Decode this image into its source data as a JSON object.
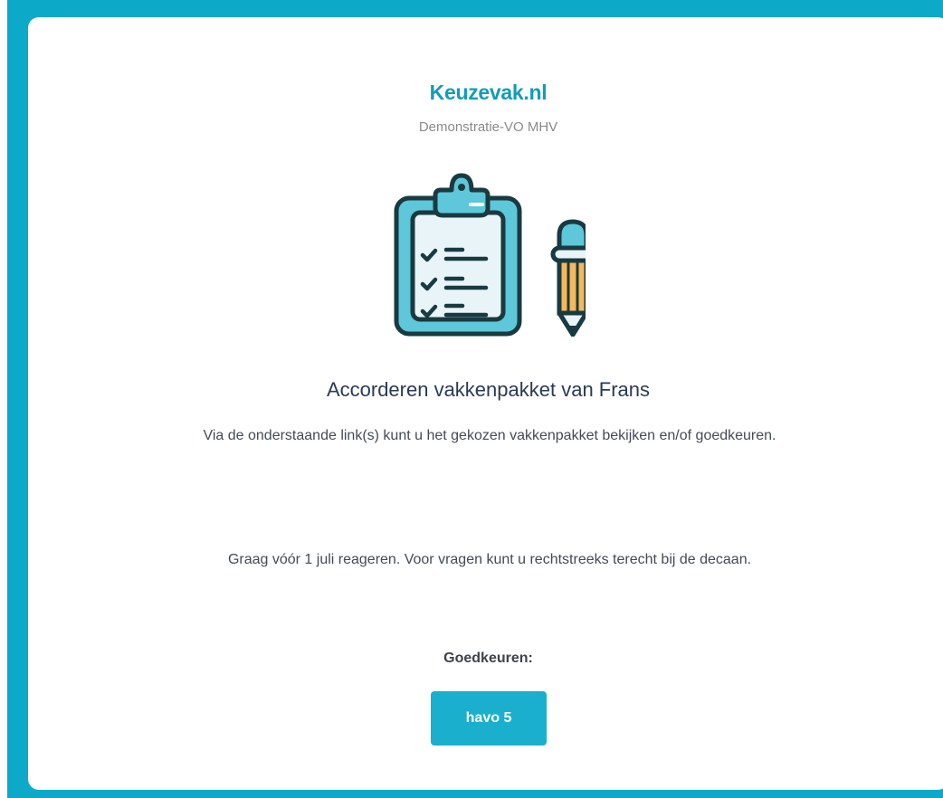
{
  "header": {
    "brand": "Keuzevak.nl",
    "school": "Demonstratie-VO MHV"
  },
  "illustration": {
    "icon": "clipboard-checklist-with-pencil-icon"
  },
  "content": {
    "title": "Accorderen vakkenpakket van Frans",
    "intro": "Via de onderstaande link(s) kunt u het gekozen vakkenpakket bekijken en/of goedkeuren.",
    "notice": "Graag vóór 1 juli reageren. Voor vragen kunt u rechtstreeks terecht bij de decaan."
  },
  "approval": {
    "label": "Goedkeuren:",
    "button_label": "havo 5"
  },
  "colors": {
    "accent": "#0ca9c8",
    "button": "#1ab0cd",
    "brand": "#139bbd"
  }
}
